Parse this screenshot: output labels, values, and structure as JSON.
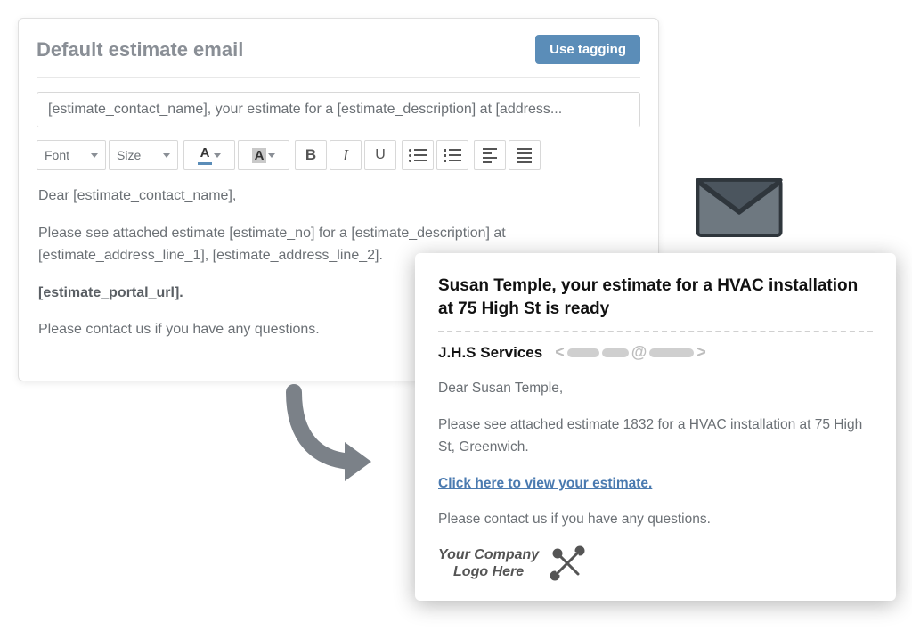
{
  "editor": {
    "title": "Default estimate email",
    "tagging_button": "Use tagging",
    "subject_value": "[estimate_contact_name], your estimate for a [estimate_description] at [address...",
    "toolbar": {
      "font_label": "Font",
      "size_label": "Size",
      "text_color_glyph": "A",
      "highlight_glyph": "A",
      "bold_glyph": "B",
      "italic_glyph": "I",
      "underline_glyph": "U"
    },
    "body": {
      "greeting": "Dear [estimate_contact_name],",
      "para1": "Please see attached estimate [estimate_no] for a [estimate_description] at [estimate_address_line_1], [estimate_address_line_2].",
      "portal": "[estimate_portal_url].",
      "closing": "Please contact us if you have any questions."
    }
  },
  "preview": {
    "subject": "Susan Temple, your estimate for a HVAC installation at 75 High St is ready",
    "from_name": "J.H.S Services",
    "body": {
      "greeting": "Dear Susan Temple,",
      "para1": "Please see attached estimate 1832 for a HVAC installation at 75 High St, Greenwich.",
      "portal_link": "Click here to view your estimate.",
      "closing": "Please contact us if you have any questions."
    },
    "logo_text_line1": "Your Company",
    "logo_text_line2": "Logo Here"
  }
}
